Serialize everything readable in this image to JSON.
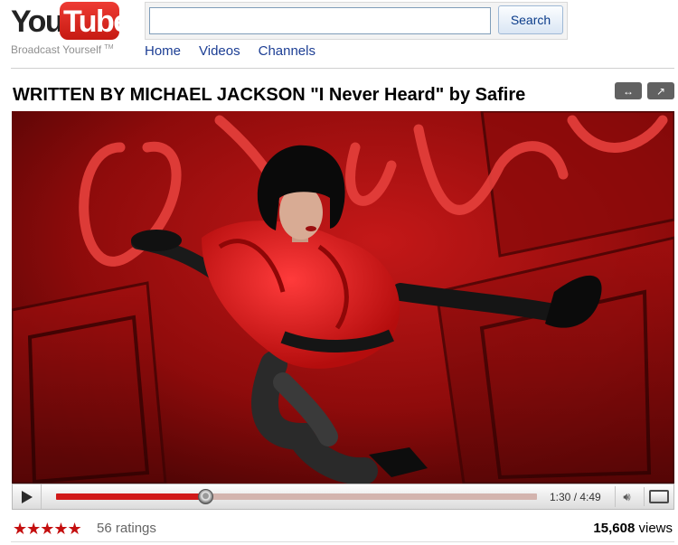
{
  "brand": {
    "logo_you": "You",
    "logo_tube": "Tube",
    "tagline": "Broadcast Yourself",
    "tagline_mark": "TM"
  },
  "search": {
    "value": "",
    "placeholder": "",
    "button_label": "Search"
  },
  "nav": {
    "items": [
      {
        "label": "Home"
      },
      {
        "label": "Videos"
      },
      {
        "label": "Channels"
      }
    ]
  },
  "video": {
    "title": "WRITTEN BY MICHAEL JACKSON \"I Never Heard\" by Safire",
    "expand_icon": "↔",
    "popout_icon": "↗",
    "accent_color": "#d11a1a"
  },
  "player": {
    "time_label": "1:30 / 4:49",
    "progress_fraction": 0.311,
    "play_icon": "play-icon",
    "volume_icon": "volume-icon",
    "fullscreen_icon": "fullscreen-icon"
  },
  "stats": {
    "stars_display": "★★★★★",
    "star_rating": 4.5,
    "ratings_label": "56 ratings",
    "views_count": "15,608",
    "views_suffix": " views"
  }
}
